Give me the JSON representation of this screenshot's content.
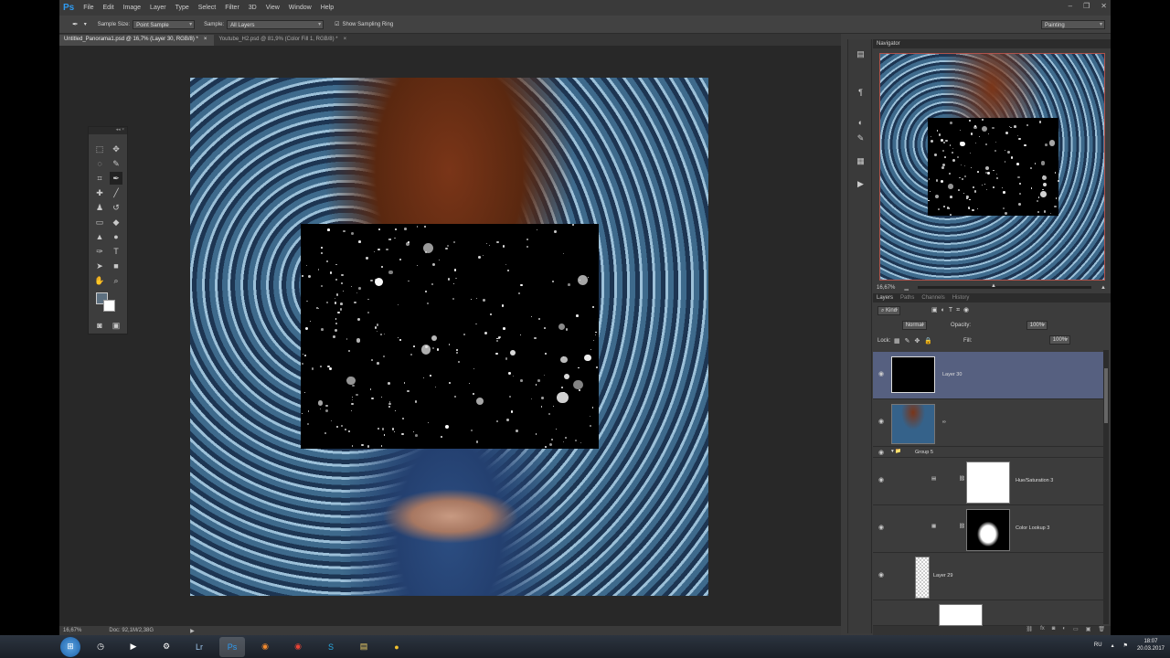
{
  "menubar": {
    "logo": "Ps",
    "items": [
      "File",
      "Edit",
      "Image",
      "Layer",
      "Type",
      "Select",
      "Filter",
      "3D",
      "View",
      "Window",
      "Help"
    ]
  },
  "options": {
    "sample_size_label": "Sample Size:",
    "sample_size_value": "Point Sample",
    "sample_label": "Sample:",
    "sample_value": "All Layers",
    "show_sampling_ring": "Show Sampling Ring",
    "workspace": "Painting"
  },
  "tabs": [
    {
      "label": "Untitled_Panorama1.psd @ 16,7% (Layer 30, RGB/8) *"
    },
    {
      "label": "Youtube_H2.psd @ 81,9% (Color Fill 1, RGB/8) *"
    }
  ],
  "status": {
    "zoom": "16,67%",
    "doc": "Doc: 92,1M/2,38G"
  },
  "navigator": {
    "title": "Navigator",
    "zoom": "16,67%"
  },
  "layers_panel": {
    "tabs": [
      "Layers",
      "Paths",
      "Channels",
      "History"
    ],
    "kind": "Kind",
    "blend_mode": "Normal",
    "opacity_label": "Opacity:",
    "opacity_value": "100%",
    "lock_label": "Lock:",
    "fill_label": "Fill:",
    "fill_value": "100%",
    "layers": [
      {
        "name": "Layer 30"
      },
      {
        "name": ""
      },
      {
        "name": "Group 5"
      },
      {
        "name": "Hue/Saturation 3"
      },
      {
        "name": "Color Lookup 3"
      },
      {
        "name": "Layer 29"
      }
    ]
  },
  "taskbar": {
    "lang": "RU",
    "time": "18:07",
    "date": "20.03.2017"
  },
  "colors": {
    "app_bg": "#3c3c3c",
    "selected_layer": "#566080",
    "ps_blue": "#2e9bf2"
  }
}
